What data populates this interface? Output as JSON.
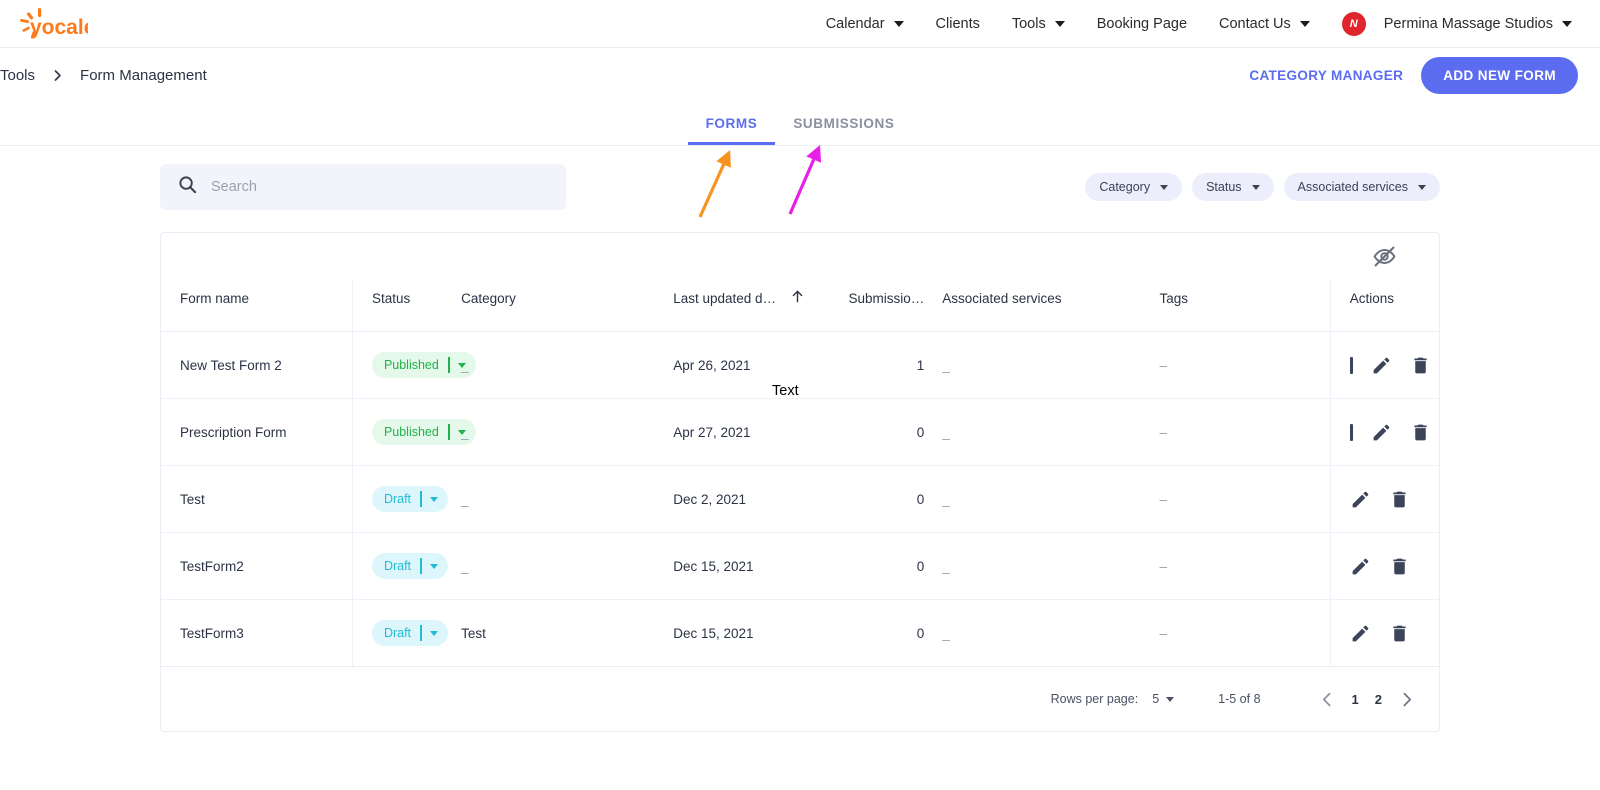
{
  "brand": {
    "name": "yocale",
    "color": "#FF7A1A"
  },
  "navbar": {
    "items": [
      {
        "label": "Calendar",
        "has_caret": true
      },
      {
        "label": "Clients",
        "has_caret": false
      },
      {
        "label": "Tools",
        "has_caret": true
      },
      {
        "label": "Booking Page",
        "has_caret": false
      },
      {
        "label": "Contact Us",
        "has_caret": true
      }
    ],
    "account": {
      "initial": "N",
      "name": "Permina Massage Studios",
      "avatar_color": "#E0252C"
    }
  },
  "breadcrumb": {
    "parent": "Tools",
    "current": "Form Management"
  },
  "header_actions": {
    "category_manager": "CATEGORY MANAGER",
    "add_new_form": "ADD NEW FORM",
    "accent": "#5B6CF0"
  },
  "tabs": [
    {
      "label": "FORMS",
      "active": true
    },
    {
      "label": "SUBMISSIONS",
      "active": false
    }
  ],
  "search": {
    "placeholder": "Search",
    "value": ""
  },
  "filters": [
    {
      "label": "Category"
    },
    {
      "label": "Status"
    },
    {
      "label": "Associated services"
    }
  ],
  "table": {
    "hide_columns_icon": "eye-off-icon",
    "columns": [
      "Form name",
      "Status",
      "Category",
      "Last updated d…",
      "Submissio…",
      "Associated services",
      "Tags",
      "Actions"
    ],
    "sort": {
      "column": "Last updated d…",
      "direction": "asc"
    },
    "rows": [
      {
        "name": "New Test Form 2",
        "status": "Published",
        "status_kind": "published",
        "category": "_",
        "last_updated": "Apr 26, 2021",
        "submissions": "1",
        "associated_services": "_",
        "tags": "–",
        "has_bar_action": true
      },
      {
        "name": "Prescription Form",
        "status": "Published",
        "status_kind": "published",
        "category": "_",
        "last_updated": "Apr 27, 2021",
        "submissions": "0",
        "associated_services": "_",
        "tags": "–",
        "has_bar_action": true
      },
      {
        "name": "Test",
        "status": "Draft",
        "status_kind": "draft",
        "category": "_",
        "last_updated": "Dec 2, 2021",
        "submissions": "0",
        "associated_services": "_",
        "tags": "–",
        "has_bar_action": false
      },
      {
        "name": "TestForm2",
        "status": "Draft",
        "status_kind": "draft",
        "category": "_",
        "last_updated": "Dec 15, 2021",
        "submissions": "0",
        "associated_services": "_",
        "tags": "–",
        "has_bar_action": false
      },
      {
        "name": "TestForm3",
        "status": "Draft",
        "status_kind": "draft",
        "category": "Test",
        "last_updated": "Dec 15, 2021",
        "submissions": "0",
        "associated_services": "_",
        "tags": "–",
        "has_bar_action": false
      }
    ]
  },
  "pagination": {
    "rows_per_page_label": "Rows per page:",
    "rows_per_page_value": "5",
    "range": "1-5 of 8",
    "pages": [
      "1",
      "2"
    ],
    "current_page": "1"
  },
  "annotations": {
    "text_label": "Text",
    "arrow_forms_color": "#F7931E",
    "arrow_submissions_color": "#E81FE8"
  },
  "status_colors": {
    "published_bg": "#E4F9EA",
    "published_fg": "#22B14C",
    "draft_bg": "#DDF6FB",
    "draft_fg": "#22BCD4"
  }
}
